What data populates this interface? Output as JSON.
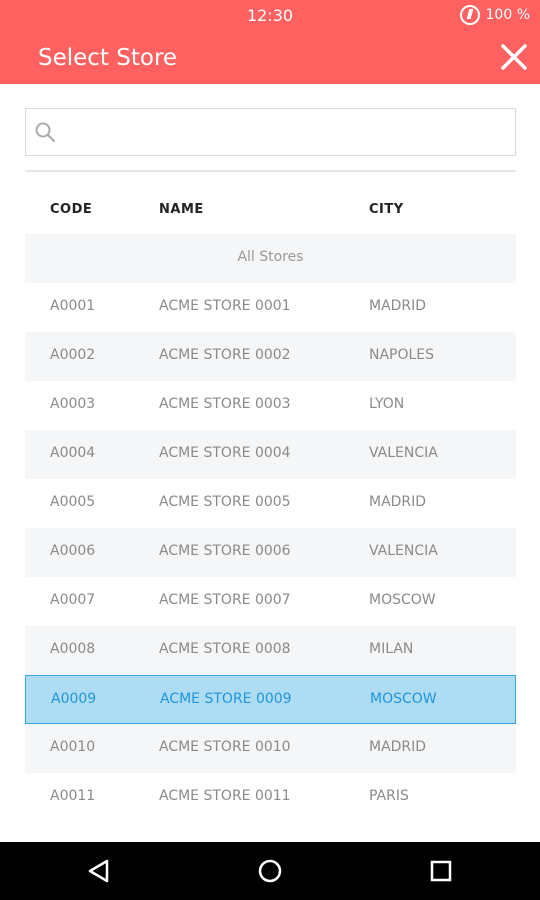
{
  "status": {
    "time": "12:30",
    "battery": "100 %"
  },
  "header": {
    "title": "Select Store"
  },
  "search": {
    "placeholder": "",
    "value": ""
  },
  "table": {
    "headers": {
      "code": "CODE",
      "name": "NAME",
      "city": "CITY"
    },
    "all_stores_label": "All Stores",
    "rows": [
      {
        "code": "A0001",
        "name": "ACME STORE 0001",
        "city": "MADRID"
      },
      {
        "code": "A0002",
        "name": "ACME STORE 0002",
        "city": "NAPOLES"
      },
      {
        "code": "A0003",
        "name": "ACME STORE 0003",
        "city": "LYON"
      },
      {
        "code": "A0004",
        "name": "ACME STORE 0004",
        "city": "VALENCIA"
      },
      {
        "code": "A0005",
        "name": "ACME STORE 0005",
        "city": "MADRID"
      },
      {
        "code": "A0006",
        "name": "ACME STORE 0006",
        "city": "VALENCIA"
      },
      {
        "code": "A0007",
        "name": "ACME STORE 0007",
        "city": "MOSCOW"
      },
      {
        "code": "A0008",
        "name": "ACME STORE 0008",
        "city": "MILAN"
      },
      {
        "code": "A0009",
        "name": "ACME STORE 0009",
        "city": "MOSCOW"
      },
      {
        "code": "A0010",
        "name": "ACME STORE 0010",
        "city": "MADRID"
      },
      {
        "code": "A0011",
        "name": "ACME STORE 0011",
        "city": "PARIS"
      }
    ],
    "selected_code": "A0009"
  },
  "colors": {
    "accent": "#ff6060",
    "selected_bg": "#aedcf2",
    "selected_text": "#1f96db"
  },
  "icons": {
    "close": "close-icon",
    "search": "search-icon",
    "back": "back-icon",
    "home": "home-icon",
    "recents": "recents-icon"
  }
}
